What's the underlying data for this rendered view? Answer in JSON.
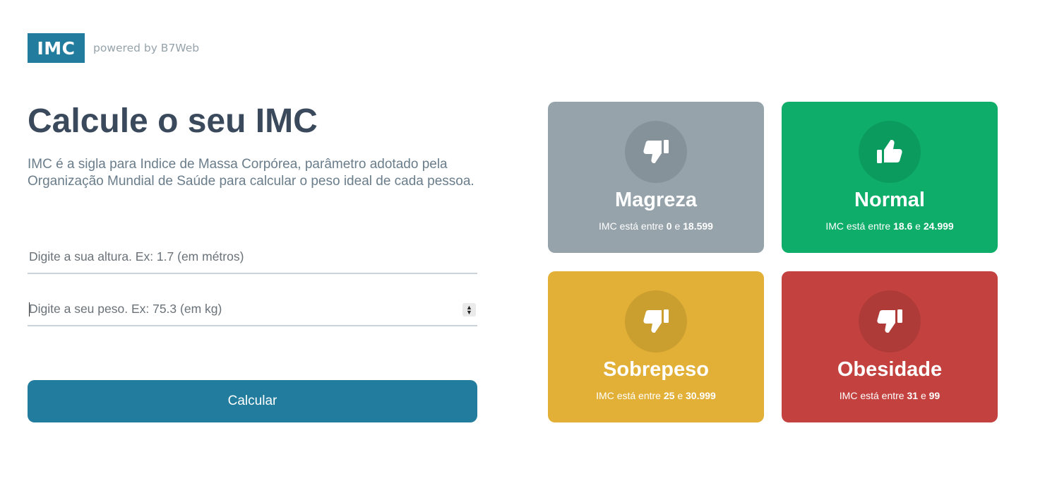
{
  "header": {
    "logo": "IMC",
    "powered": "powered by B7Web"
  },
  "main": {
    "title": "Calcule o seu IMC",
    "description": "IMC é a sigla para Indice de Massa Corpórea, parâmetro adotado pela Organização Mundial de Saúde para calcular o peso ideal de cada pessoa.",
    "height_input": {
      "value": "",
      "placeholder": "Digite a sua altura. Ex: 1.7 (em métros)"
    },
    "weight_input": {
      "value": "",
      "placeholder": "Digite a seu peso. Ex: 75.3 (em kg)"
    },
    "calc_button": "Calcular"
  },
  "levels": [
    {
      "title": "Magreza",
      "prefix": "IMC está entre",
      "min": "0",
      "sep": "e",
      "max": "18.599",
      "icon": "thumbs-down-icon",
      "color": "#96a3ab"
    },
    {
      "title": "Normal",
      "prefix": "IMC está entre",
      "min": "18.6",
      "sep": "e",
      "max": "24.999",
      "icon": "thumbs-up-icon",
      "color": "#0ead69"
    },
    {
      "title": "Sobrepeso",
      "prefix": "IMC está entre",
      "min": "25",
      "sep": "e",
      "max": "30.999",
      "icon": "thumbs-down-icon",
      "color": "#e2b036"
    },
    {
      "title": "Obesidade",
      "prefix": "IMC está entre",
      "min": "31",
      "sep": "e",
      "max": "99",
      "icon": "thumbs-down-icon",
      "color": "#c3423f"
    }
  ]
}
